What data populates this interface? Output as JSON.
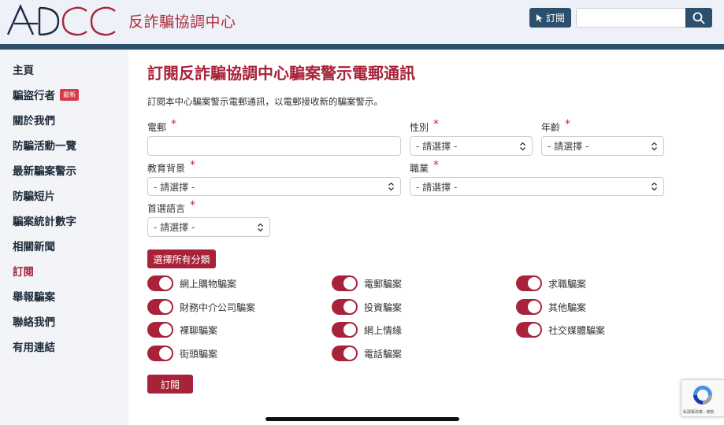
{
  "header": {
    "logo_text": "ADCC",
    "logo_subtitle": "反詐騙協調中心",
    "subscribe_label": "訂閱",
    "search": {
      "placeholder": "",
      "value": ""
    }
  },
  "sidebar": {
    "items": [
      {
        "label": "主頁"
      },
      {
        "label": "騙盜行者",
        "badge": "最新"
      },
      {
        "label": "關於我們"
      },
      {
        "label": "防騙活動一覽"
      },
      {
        "label": "最新騙案警示"
      },
      {
        "label": "防騙短片"
      },
      {
        "label": "騙案統計數字"
      },
      {
        "label": "相關新聞"
      },
      {
        "label": "訂閱",
        "active": true
      },
      {
        "label": "舉報騙案"
      },
      {
        "label": "聯絡我們"
      },
      {
        "label": "有用連結"
      }
    ]
  },
  "main": {
    "title": "訂閱反詐騙協調中心騙案警示電郵通訊",
    "intro": "訂閱本中心騙案警示電郵通訊，以電郵接收新的騙案警示。",
    "required_mark": "*",
    "fields": {
      "email": {
        "label": "電郵",
        "value": ""
      },
      "gender": {
        "label": "性別",
        "value": "- 請選擇 -"
      },
      "age": {
        "label": "年齡",
        "value": "- 請選擇 -"
      },
      "education": {
        "label": "教育背景",
        "value": "- 請選擇 -"
      },
      "occupation": {
        "label": "職業",
        "value": "- 請選擇 -"
      },
      "language": {
        "label": "首選語言",
        "value": "- 請選擇 -"
      }
    },
    "select_all_label": "選擇所有分類",
    "categories": [
      {
        "label": "網上購物騙案",
        "checked": true
      },
      {
        "label": "電郵騙案",
        "checked": true
      },
      {
        "label": "求職騙案",
        "checked": true
      },
      {
        "label": "財務中介公司騙案",
        "checked": true
      },
      {
        "label": "投資騙案",
        "checked": true
      },
      {
        "label": "其他騙案",
        "checked": true
      },
      {
        "label": "裸聊騙案",
        "checked": true
      },
      {
        "label": "網上情緣",
        "checked": true
      },
      {
        "label": "社交媒體騙案",
        "checked": true
      },
      {
        "label": "街頭騙案",
        "checked": true
      },
      {
        "label": "電話騙案",
        "checked": true
      }
    ],
    "submit_label": "訂閱"
  },
  "recaptcha": {
    "text": "私隱權政策 - 條款"
  },
  "colors": {
    "brand_red": "#a8233a",
    "navy": "#2d4f6e"
  }
}
